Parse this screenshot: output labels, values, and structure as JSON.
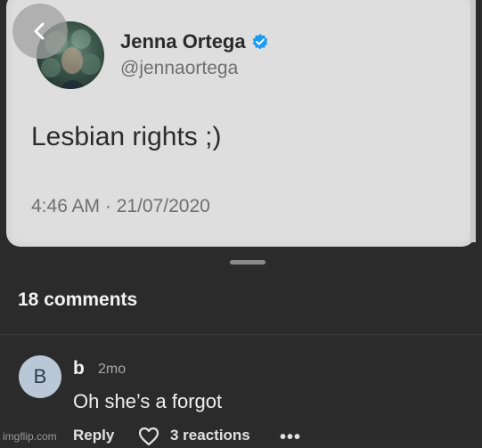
{
  "tweet": {
    "author_name": "Jenna Ortega",
    "author_handle": "@jennaortega",
    "text": "Lesbian rights ;)",
    "timestamp": "4:46 AM · 21/07/2020",
    "verified": true
  },
  "comments": {
    "header": "18 comments",
    "items": [
      {
        "avatar_initial": "B",
        "username": "b",
        "age": "2mo",
        "text": "Oh she’s a forgot",
        "reply_label": "Reply",
        "reactions_label": "3 reactions",
        "more_label": "•••"
      }
    ]
  },
  "watermark": "imgflip.com",
  "icons": {
    "back": "chevron-left-icon",
    "verified": "verified-badge-icon",
    "reaction": "heart-icon",
    "more": "more-dots-icon"
  },
  "colors": {
    "verified_blue": "#1d9bf0",
    "sheet_background": "#2b2b2b",
    "card_background": "#dedede"
  }
}
